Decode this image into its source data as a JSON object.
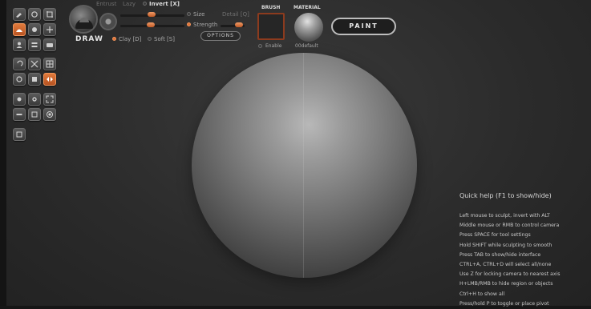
{
  "top_labels": {
    "inverse_hint_left": "Entrust",
    "inverse_hint_right": "Lazy",
    "invert": "Invert [X]",
    "size": "Size",
    "detail": "Detail [Q]",
    "strength": "Strength",
    "options": "OPTIONS",
    "draw": "DRAW",
    "clay": "Clay [D]",
    "soft": "Soft [S]"
  },
  "brush": {
    "header": "BRUSH",
    "enable": "Enable"
  },
  "material": {
    "header": "MATERIAL",
    "name": "00default"
  },
  "paint_button": "PAINT",
  "help": {
    "title": "Quick help (F1 to show/hide)",
    "lines": [
      "Left mouse to sculpt, invert with ALT",
      "Middle mouse or RMB to control camera",
      "Press SPACE for tool settings",
      "Hold SHIFT while sculpting to smooth",
      "Press TAB to show/hide interface",
      "CTRL+A, CTRL+D will select all/none",
      "Use Z for locking camera to nearest axis",
      "H+LMB/RMB to hide region or objects",
      "Ctrl+H to show all",
      "Press/hold P to toggle or place pivot"
    ]
  },
  "sliders": {
    "size_level": 0.15,
    "strength_level": 0.85
  },
  "colors": {
    "accent": "#e0743a",
    "brush_border": "#8c3b1e"
  },
  "tool_icons": [
    "brush-icon",
    "rotate-icon",
    "crop-icon",
    "sculpt-active-icon",
    "mask-icon",
    "move-icon",
    "user-icon",
    "layers-icon",
    "folder-icon",
    "undo-icon",
    "transform-icon",
    "grid-icon",
    "refresh-icon",
    "paint-icon",
    "symmetry-active-icon",
    "camera-icon",
    "settings-icon",
    "expand-icon",
    "minus-icon",
    "scale-icon",
    "pivot-icon",
    "reset-icon"
  ]
}
